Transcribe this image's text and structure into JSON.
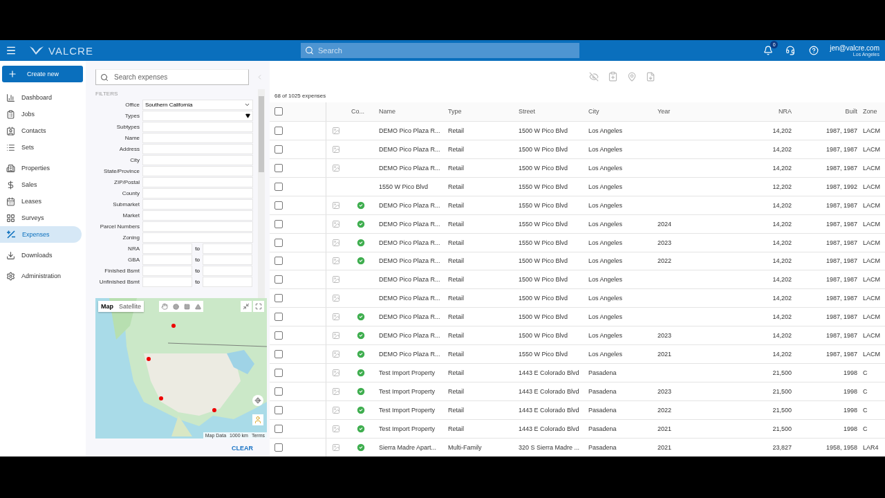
{
  "header": {
    "logo": "VALCRE",
    "search": {
      "placeholder": "Search"
    },
    "notifications": {
      "badge": "0"
    },
    "user": {
      "email": "jen@valcre.com",
      "office": "Los Angeles"
    }
  },
  "sidebar": {
    "create_button": "Create new",
    "groups": [
      {
        "items": [
          {
            "label": "Dashboard",
            "selected": false
          },
          {
            "label": "Jobs",
            "selected": false
          },
          {
            "label": "Contacts",
            "selected": false
          },
          {
            "label": "Sets",
            "selected": false
          }
        ]
      },
      {
        "items": [
          {
            "label": "Properties",
            "selected": false
          },
          {
            "label": "Sales",
            "selected": false
          },
          {
            "label": "Leases",
            "selected": false
          },
          {
            "label": "Surveys",
            "selected": false
          },
          {
            "label": "Expenses",
            "selected": true
          }
        ]
      },
      {
        "items": [
          {
            "label": "Downloads",
            "selected": false
          }
        ]
      },
      {
        "items": [
          {
            "label": "Administration",
            "selected": false
          }
        ]
      }
    ]
  },
  "filters": {
    "search": {
      "placeholder": "Search expenses"
    },
    "heading": "FILTERS",
    "fields": [
      {
        "label": "Office",
        "kind": "select",
        "value": "Southern California"
      },
      {
        "label": "Types",
        "kind": "dropdown"
      },
      {
        "label": "Subtypes",
        "kind": "text"
      },
      {
        "label": "Name",
        "kind": "text"
      },
      {
        "label": "Address",
        "kind": "text"
      },
      {
        "label": "City",
        "kind": "text"
      },
      {
        "label": "State/Province",
        "kind": "text"
      },
      {
        "label": "ZIP/Postal",
        "kind": "text"
      },
      {
        "label": "County",
        "kind": "text"
      },
      {
        "label": "Submarket",
        "kind": "text"
      },
      {
        "label": "Market",
        "kind": "text"
      },
      {
        "label": "Parcel Numbers",
        "kind": "text"
      },
      {
        "label": "Zoning",
        "kind": "text"
      },
      {
        "label": "NRA",
        "kind": "range",
        "separator": "to"
      },
      {
        "label": "GBA",
        "kind": "range",
        "separator": "to"
      },
      {
        "label": "Finished Bsmt",
        "kind": "range",
        "separator": "to"
      },
      {
        "label": "Unfinished Bsmt",
        "kind": "range",
        "separator": "to"
      }
    ],
    "map": {
      "tabs": [
        {
          "label": "Map",
          "selected": true
        },
        {
          "label": "Satellite",
          "selected": false
        }
      ],
      "attribution": [
        "Map Data",
        "1000 km",
        "Terms"
      ]
    },
    "clear_button": "CLEAR"
  },
  "results": {
    "count": "68 of 1025 expenses",
    "select_all": {
      "checked": false
    },
    "status_column": "Co...",
    "columns": [
      "Name",
      "Type",
      "Street",
      "City",
      "Year",
      "NRA",
      "Built",
      "Zone"
    ],
    "rows": [
      {
        "selected": false,
        "has_photo": true,
        "complete": false,
        "cells": [
          "DEMO Pico Plaza R...",
          "Retail",
          "1500 W Pico Blvd",
          "Los Angeles",
          "",
          "14,202",
          "1987, 1987",
          "LACM"
        ]
      },
      {
        "selected": false,
        "has_photo": true,
        "complete": false,
        "cells": [
          "DEMO Pico Plaza R...",
          "Retail",
          "1500 W Pico Blvd",
          "Los Angeles",
          "",
          "14,202",
          "1987, 1987",
          "LACM"
        ]
      },
      {
        "selected": false,
        "has_photo": true,
        "complete": false,
        "cells": [
          "DEMO Pico Plaza R...",
          "Retail",
          "1500 W Pico Blvd",
          "Los Angeles",
          "",
          "14,202",
          "1987, 1987",
          "LACM"
        ]
      },
      {
        "selected": false,
        "has_photo": false,
        "complete": false,
        "cells": [
          "1550 W Pico Blvd",
          "Retail",
          "1550 W Pico Blvd",
          "Los Angeles",
          "",
          "12,202",
          "1987, 1992",
          "LACM"
        ]
      },
      {
        "selected": false,
        "has_photo": true,
        "complete": true,
        "cells": [
          "DEMO Pico Plaza R...",
          "Retail",
          "1550 W Pico Blvd",
          "Los Angeles",
          "",
          "14,202",
          "1987, 1987",
          "LACM"
        ]
      },
      {
        "selected": false,
        "has_photo": true,
        "complete": true,
        "cells": [
          "DEMO Pico Plaza R...",
          "Retail",
          "1550 W Pico Blvd",
          "Los Angeles",
          "2024",
          "14,202",
          "1987, 1987",
          "LACM"
        ]
      },
      {
        "selected": false,
        "has_photo": true,
        "complete": true,
        "cells": [
          "DEMO Pico Plaza R...",
          "Retail",
          "1550 W Pico Blvd",
          "Los Angeles",
          "2023",
          "14,202",
          "1987, 1987",
          "LACM"
        ]
      },
      {
        "selected": false,
        "has_photo": true,
        "complete": true,
        "cells": [
          "DEMO Pico Plaza R...",
          "Retail",
          "1500 W Pico Blvd",
          "Los Angeles",
          "2022",
          "14,202",
          "1987, 1987",
          "LACM"
        ]
      },
      {
        "selected": false,
        "has_photo": true,
        "complete": false,
        "cells": [
          "DEMO Pico Plaza R...",
          "Retail",
          "1500 W Pico Blvd",
          "Los Angeles",
          "",
          "14,202",
          "1987, 1987",
          "LACM"
        ]
      },
      {
        "selected": false,
        "has_photo": true,
        "complete": false,
        "cells": [
          "DEMO Pico Plaza R...",
          "Retail",
          "1500 W Pico Blvd",
          "Los Angeles",
          "",
          "14,202",
          "1987, 1987",
          "LACM"
        ]
      },
      {
        "selected": false,
        "has_photo": true,
        "complete": true,
        "cells": [
          "DEMO Pico Plaza R...",
          "Retail",
          "1500 W Pico Blvd",
          "Los Angeles",
          "",
          "14,202",
          "1987, 1987",
          "LACM"
        ]
      },
      {
        "selected": false,
        "has_photo": true,
        "complete": true,
        "cells": [
          "DEMO Pico Plaza R...",
          "Retail",
          "1500 W Pico Blvd",
          "Los Angeles",
          "2023",
          "14,202",
          "1987, 1987",
          "LACM"
        ]
      },
      {
        "selected": false,
        "has_photo": true,
        "complete": true,
        "cells": [
          "DEMO Pico Plaza R...",
          "Retail",
          "1550 W Pico Blvd",
          "Los Angeles",
          "2021",
          "14,202",
          "1987, 1987",
          "LACM"
        ]
      },
      {
        "selected": false,
        "has_photo": true,
        "complete": true,
        "cells": [
          "Test Import Property",
          "Retail",
          "1443 E Colorado Blvd",
          "Pasadena",
          "",
          "21,500",
          "1998",
          "C"
        ]
      },
      {
        "selected": false,
        "has_photo": true,
        "complete": true,
        "cells": [
          "Test Import Property",
          "Retail",
          "1443 E Colorado Blvd",
          "Pasadena",
          "2023",
          "21,500",
          "1998",
          "C"
        ]
      },
      {
        "selected": false,
        "has_photo": true,
        "complete": true,
        "cells": [
          "Test Import Property",
          "Retail",
          "1443 E Colorado Blvd",
          "Pasadena",
          "2022",
          "21,500",
          "1998",
          "C"
        ]
      },
      {
        "selected": false,
        "has_photo": true,
        "complete": true,
        "cells": [
          "Test Import Property",
          "Retail",
          "1443 E Colorado Blvd",
          "Pasadena",
          "2021",
          "21,500",
          "1998",
          "C"
        ]
      },
      {
        "selected": false,
        "has_photo": true,
        "complete": true,
        "cells": [
          "Sierra Madre Apart...",
          "Multi-Family",
          "320 S Sierra Madre ...",
          "Pasadena",
          "2021",
          "23,827",
          "1958, 1958",
          "LAR4"
        ]
      }
    ]
  }
}
